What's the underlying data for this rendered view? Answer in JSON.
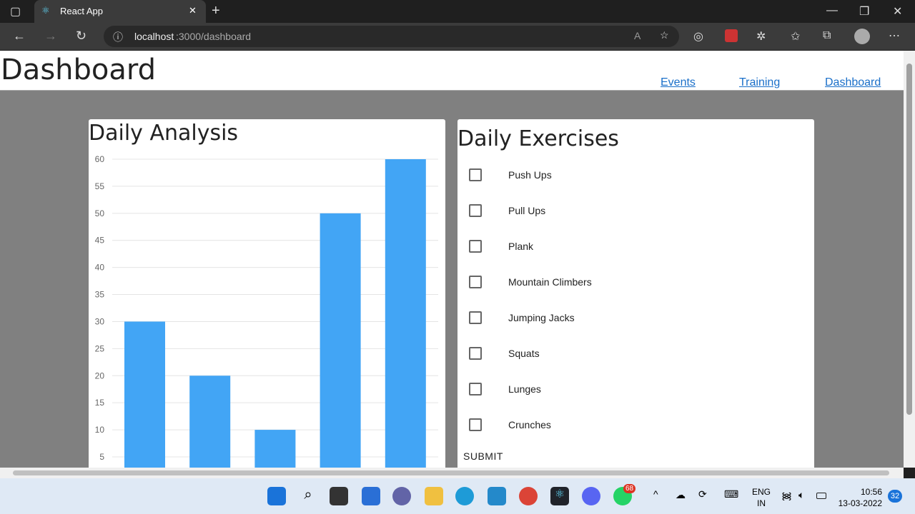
{
  "browser": {
    "tab_title": "React App",
    "url_host": "localhost",
    "url_path": ":3000/dashboard"
  },
  "header": {
    "title": "Dashboard",
    "nav": [
      "Events",
      "Training",
      "Dashboard"
    ]
  },
  "analysis": {
    "title": "Daily Analysis"
  },
  "chart_data": {
    "type": "bar",
    "values": [
      30,
      20,
      10,
      50,
      60
    ],
    "yticks": [
      5,
      10,
      15,
      20,
      25,
      30,
      35,
      40,
      45,
      50,
      55,
      60
    ],
    "ylim": [
      0,
      60
    ],
    "grid": true,
    "bar_color": "#42a5f5"
  },
  "exercises": {
    "title": "Daily Exercises",
    "items": [
      "Push Ups",
      "Pull Ups",
      "Plank",
      "Mountain Climbers",
      "Jumping Jacks",
      "Squats",
      "Lunges",
      "Crunches"
    ],
    "submit": "SUBMIT"
  },
  "taskbar": {
    "whatsapp_badge": "68",
    "lang": "ENG",
    "region": "IN",
    "time": "10:56",
    "date": "13-03-2022",
    "notifications": "32"
  }
}
